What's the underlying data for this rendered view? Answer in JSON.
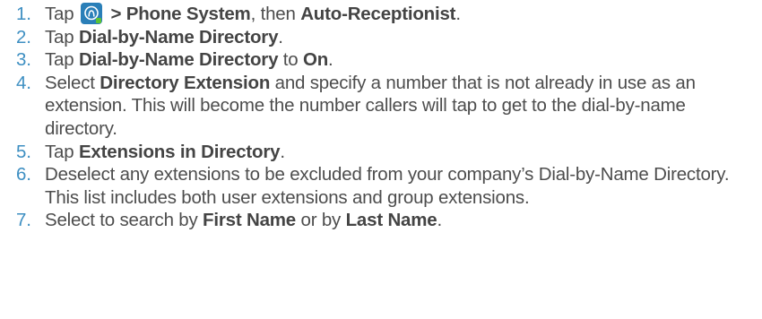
{
  "steps": [
    {
      "number": "1.",
      "parts": {
        "p1": "Tap ",
        "icon": "profile-app-icon",
        "b1": " > Phone System",
        "p2": ", then ",
        "b2": "Auto-Receptionist",
        "p3": "."
      }
    },
    {
      "number": "2.",
      "parts": {
        "p1": "Tap ",
        "b1": "Dial-by-Name Directory",
        "p2": "."
      }
    },
    {
      "number": "3.",
      "parts": {
        "p1": "Tap ",
        "b1": "Dial-by-Name Directory",
        "p2": " to ",
        "b2": "On",
        "p3": "."
      }
    },
    {
      "number": "4.",
      "parts": {
        "p1": "Select ",
        "b1": "Directory Extension",
        "p2": " and specify a number that is not already in use as an extension. This will become the number callers will tap to get to the dial-by-name directory."
      }
    },
    {
      "number": "5.",
      "parts": {
        "p1": "Tap ",
        "b1": "Extensions in Directory",
        "p2": "."
      }
    },
    {
      "number": "6.",
      "parts": {
        "p1": "Deselect any extensions to be excluded from your company’s Dial-by-Name Directory. This list includes both user extensions and group extensions."
      }
    },
    {
      "number": "7.",
      "parts": {
        "p1": "Select to search by ",
        "b1": "First Name",
        "p2": " or by ",
        "b2": "Last Name",
        "p3": "."
      }
    }
  ],
  "colors": {
    "number": "#3e8fc2",
    "text": "#4d4d4d",
    "icon_bg": "#2a7fb8",
    "icon_dot": "#5bc236"
  }
}
